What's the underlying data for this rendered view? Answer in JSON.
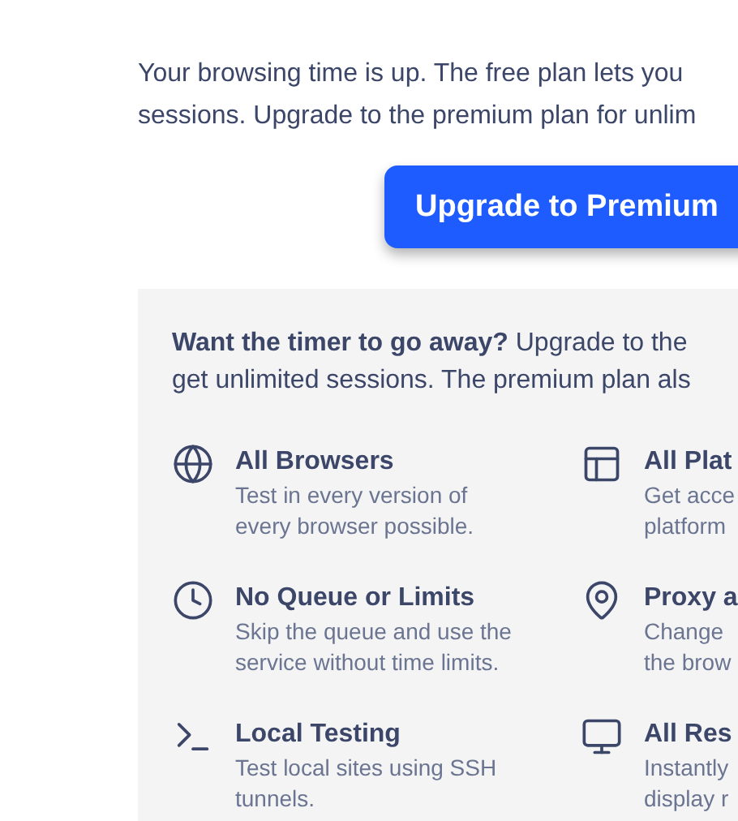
{
  "intro_lines": [
    "Your browsing time is up. The free plan lets you",
    "sessions. Upgrade to the premium plan for unlim"
  ],
  "upgrade_button": {
    "label": "Upgrade to Premium"
  },
  "panel": {
    "lines": [
      "**Want the timer to go away?** Upgrade to the",
      "get unlimited sessions. The premium plan als"
    ],
    "features": [
      {
        "title": "All Browsers",
        "description_lines": [
          "Test in every version of",
          "every browser possible."
        ]
      },
      {
        "title": "All Plat",
        "description_lines": [
          "Get acce",
          "platform"
        ]
      },
      {
        "title": "No Queue or Limits",
        "description_lines": [
          "Skip the queue and use the",
          "service without time limits."
        ]
      },
      {
        "title": "Proxy a",
        "description_lines": [
          "Change",
          "the brow"
        ]
      },
      {
        "title": "Local Testing",
        "description_lines": [
          "Test local sites using SSH",
          "tunnels."
        ]
      },
      {
        "title": "All Res",
        "description_lines": [
          "Instantly",
          "display r"
        ]
      }
    ]
  }
}
